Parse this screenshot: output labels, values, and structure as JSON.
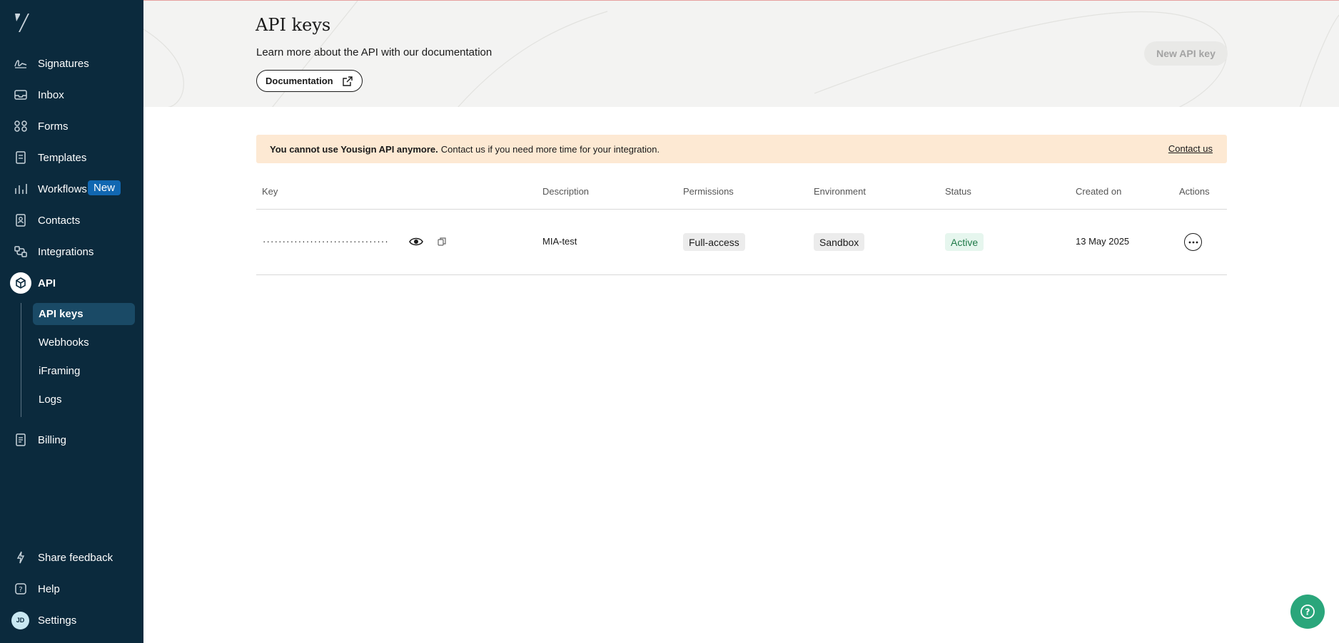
{
  "sidebar": {
    "items": [
      {
        "label": "Signatures",
        "icon": "signature-icon"
      },
      {
        "label": "Inbox",
        "icon": "inbox-icon"
      },
      {
        "label": "Forms",
        "icon": "forms-icon"
      },
      {
        "label": "Templates",
        "icon": "templates-icon"
      },
      {
        "label": "Workflows",
        "icon": "workflows-icon",
        "badge": "New"
      },
      {
        "label": "Contacts",
        "icon": "contacts-icon"
      },
      {
        "label": "Integrations",
        "icon": "integrations-icon"
      },
      {
        "label": "API",
        "icon": "api-icon"
      }
    ],
    "api_sub": [
      "API keys",
      "Webhooks",
      "iFraming",
      "Logs"
    ],
    "billing": "Billing",
    "bottom": {
      "feedback": "Share feedback",
      "help": "Help",
      "settings": "Settings",
      "avatar_initials": "JD"
    }
  },
  "header": {
    "title": "API keys",
    "subtitle": "Learn more about the API with our documentation",
    "doc_button": "Documentation",
    "new_key_button": "New API key"
  },
  "banner": {
    "bold": "You cannot use Yousign API anymore.",
    "text": "Contact us if you need more time for your integration.",
    "link": "Contact us",
    "color": "#fde9d3"
  },
  "table": {
    "columns": [
      "Key",
      "Description",
      "Permissions",
      "Environment",
      "Status",
      "Created on",
      "Actions"
    ],
    "rows": [
      {
        "key": "································",
        "description": "MIA-test",
        "permissions": "Full-access",
        "environment": "Sandbox",
        "status": "Active",
        "created_on": "13 May 2025"
      }
    ]
  },
  "colors": {
    "sidebar_bg": "#0b2a3d",
    "accent": "#1167b1",
    "status_active": "#1f7a48",
    "help_fab": "#2aa67b"
  }
}
